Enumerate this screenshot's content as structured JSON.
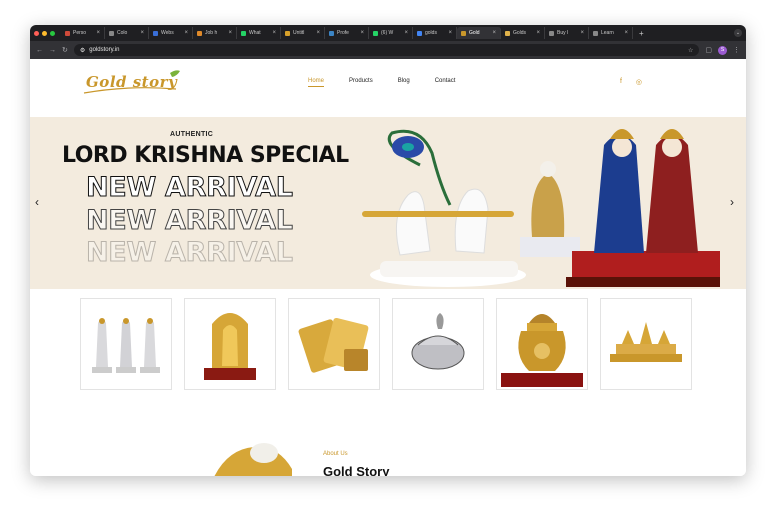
{
  "browser": {
    "tabs": [
      {
        "label": "Perso",
        "fav": "#d04a3a"
      },
      {
        "label": "Colo",
        "fav": "#888"
      },
      {
        "label": "Webs",
        "fav": "#3a6fd8"
      },
      {
        "label": "Job h",
        "fav": "#e08a2a"
      },
      {
        "label": "What",
        "fav": "#25d366"
      },
      {
        "label": "Untitl",
        "fav": "#d8a12a"
      },
      {
        "label": "Profe",
        "fav": "#3b84c4"
      },
      {
        "label": "(6) W",
        "fav": "#25d366"
      },
      {
        "label": "golds",
        "fav": "#4285f4"
      },
      {
        "label": "Gold",
        "fav": "#c9972b",
        "active": true
      },
      {
        "label": "Golds",
        "fav": "#e0b24a"
      },
      {
        "label": "Buy I",
        "fav": "#888"
      },
      {
        "label": "Learn",
        "fav": "#888"
      }
    ],
    "new_tab": "+",
    "url": "goldstory.in",
    "profile_initial": "S"
  },
  "header": {
    "logo_text": "Gold story",
    "nav": [
      "Home",
      "Products",
      "Blog",
      "Contact"
    ],
    "social": [
      "f",
      "◎"
    ]
  },
  "hero": {
    "subtitle": "AUTHENTIC",
    "title": "LORD KRISHNA SPECIAL",
    "arrival": "NEW ARRIVAL",
    "prev": "‹",
    "next": "›"
  },
  "products": [
    {
      "name": "silver-deities-trio-image"
    },
    {
      "name": "gold-idol-frame-image"
    },
    {
      "name": "gold-playing-cards-image"
    },
    {
      "name": "silver-peacock-box-image"
    },
    {
      "name": "gold-kalash-image"
    },
    {
      "name": "gold-temple-model-image"
    }
  ],
  "about": {
    "subtitle": "About Us",
    "title": "Gold Story"
  },
  "colors": {
    "gold": "#c9972b",
    "hero_bg": "#f3ebde"
  }
}
